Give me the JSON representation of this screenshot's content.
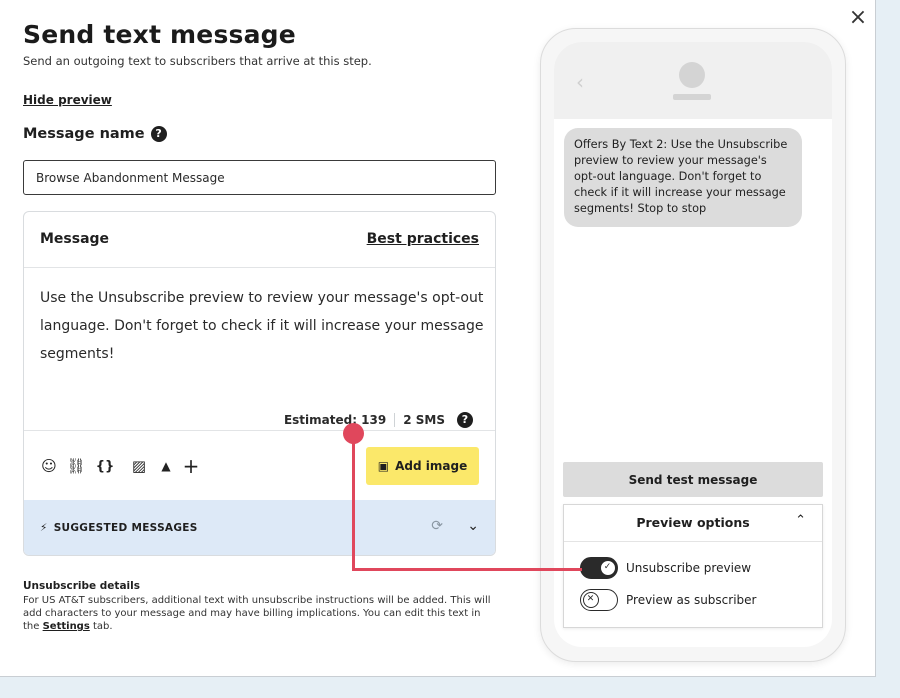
{
  "modal": {
    "close_label": "×",
    "title": "Send text message",
    "subtitle": "Send an outgoing text to subscribers that arrive at this step.",
    "hide_preview": "Hide preview"
  },
  "message_name": {
    "label": "Message name",
    "help": "?",
    "value": "Browse Abandonment Message"
  },
  "message_card": {
    "title": "Message",
    "best_practices": "Best practices",
    "body": "Use the Unsubscribe preview to review your message's opt-out language. Don't forget to check if it will increase your message segments!",
    "estimated": "Estimated: 139",
    "sms_count": "2 SMS",
    "help": "?",
    "toolbar": {
      "icons": [
        "emoji-icon",
        "link-icon",
        "variables-icon",
        "image-gif-icon",
        "bell-icon",
        "plus-icon"
      ],
      "emoji_glyph": "☺",
      "link_glyph": "⛓",
      "variables_glyph": "{}",
      "gif_glyph": "▨",
      "bell_glyph": "▲",
      "plus_glyph": "+",
      "add_image": "Add image",
      "add_image_glyph": "▣"
    },
    "suggested": {
      "label": "SUGGESTED MESSAGES",
      "wand_glyph": "⚡",
      "refresh_glyph": "⟳",
      "chevron_glyph": "⌄"
    }
  },
  "unsubscribe": {
    "title": "Unsubscribe details",
    "body_before": "For US AT&T subscribers, additional text with unsubscribe instructions will be added. This will add characters to your message and may have billing implications. You can edit this text in the ",
    "link": "Settings",
    "body_after": " tab."
  },
  "phone": {
    "back_glyph": "‹",
    "bubble": "Offers By Text 2: Use the Unsubscribe preview to review your message's opt-out language. Don't forget to check if it will increase your message segments! Stop to stop",
    "send_test": "Send test message",
    "preview_options": {
      "title": "Preview options",
      "chevron_glyph": "⌃",
      "toggles": [
        {
          "label": "Unsubscribe preview",
          "on": true,
          "glyph": "✓"
        },
        {
          "label": "Preview as subscriber",
          "on": false,
          "glyph": "✕"
        }
      ]
    }
  },
  "colors": {
    "accent_yellow": "#fbe86a",
    "suggested_bg": "#dde9f7",
    "annotation": "#e0475c",
    "page_bg": "#e6eff5"
  }
}
